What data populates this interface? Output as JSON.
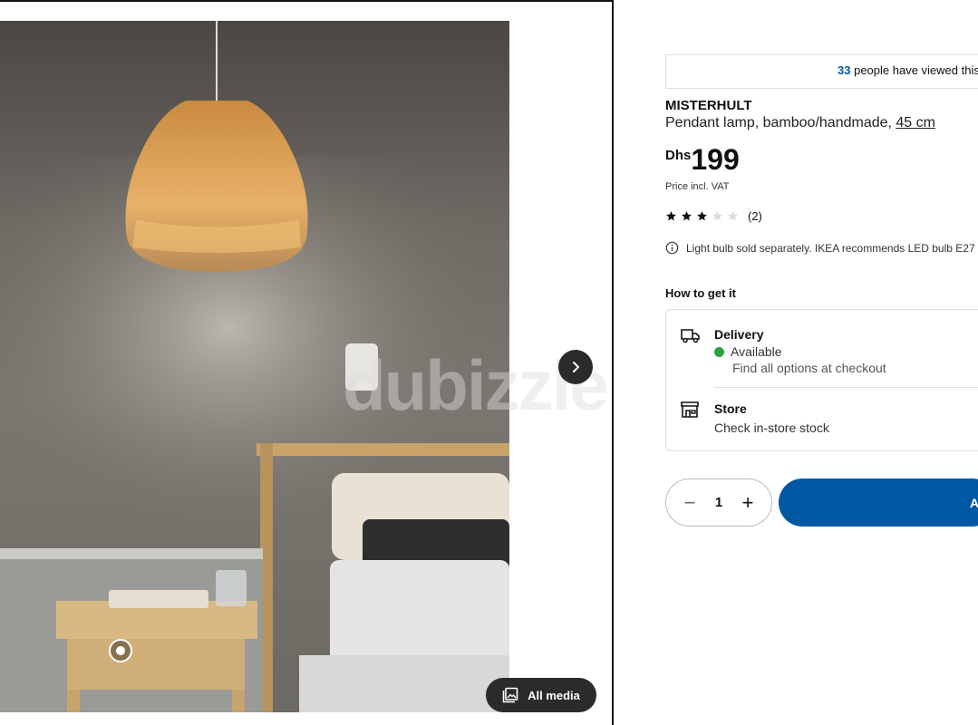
{
  "gallery": {
    "media_button_label": "All media",
    "watermark_text": "dubizzle"
  },
  "product": {
    "viewed_count": "33",
    "viewed_text": "people have viewed this",
    "name": "MISTERHULT",
    "description": "Pendant lamp, bamboo/handmade,",
    "size_link": "45 cm",
    "price_currency": "Dhs",
    "price_value": "199",
    "price_note": "Price incl. VAT",
    "rating_value": 3,
    "rating_max": 5,
    "review_count": "(2)",
    "info_note": "Light bulb sold separately. IKEA recommends LED bulb E27 g"
  },
  "fulfilment": {
    "heading": "How to get it",
    "delivery_title": "Delivery",
    "delivery_status": "Available",
    "delivery_note": "Find all options at checkout",
    "store_title": "Store",
    "store_note": "Check in-store stock"
  },
  "cart": {
    "quantity": "1",
    "add_label": "A"
  },
  "colors": {
    "accent": "#0058a3",
    "available": "#2ea143",
    "button_dark": "#2b2b2b"
  }
}
